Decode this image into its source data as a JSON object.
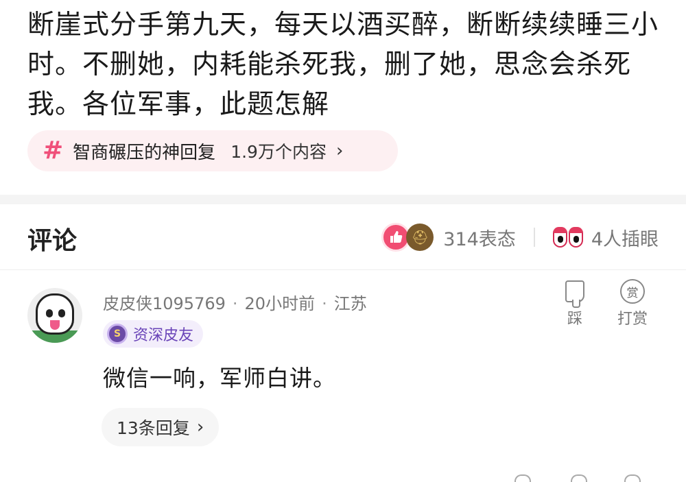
{
  "post": {
    "text": "断崖式分手第九天，每天以酒买醉，断断续续睡三小时。不删她，内耗能杀死我，删了她，思念会杀死我。各位军事，此题怎解"
  },
  "topic": {
    "icon": "hash-icon",
    "title": "智商碾压的神回复",
    "count": "1.9万个内容",
    "arrow": "›"
  },
  "comments_header": {
    "title": "评论",
    "reaction_count": "314表态",
    "insert_count": "4人插眼"
  },
  "comment": {
    "username": "皮皮侠1095769",
    "time": "20小时前",
    "location": "江苏",
    "separator": "·",
    "badge": "资深皮友",
    "body": "微信一响，军师白讲。",
    "replies": "13条回复",
    "replies_arrow": "›",
    "dislike_label": "踩",
    "reward_label": "打赏",
    "reward_icon_char": "赏"
  },
  "colors": {
    "accent_pink": "#f14d72",
    "topic_bg": "#fdf0f2",
    "badge_purple": "#6a44b8"
  }
}
